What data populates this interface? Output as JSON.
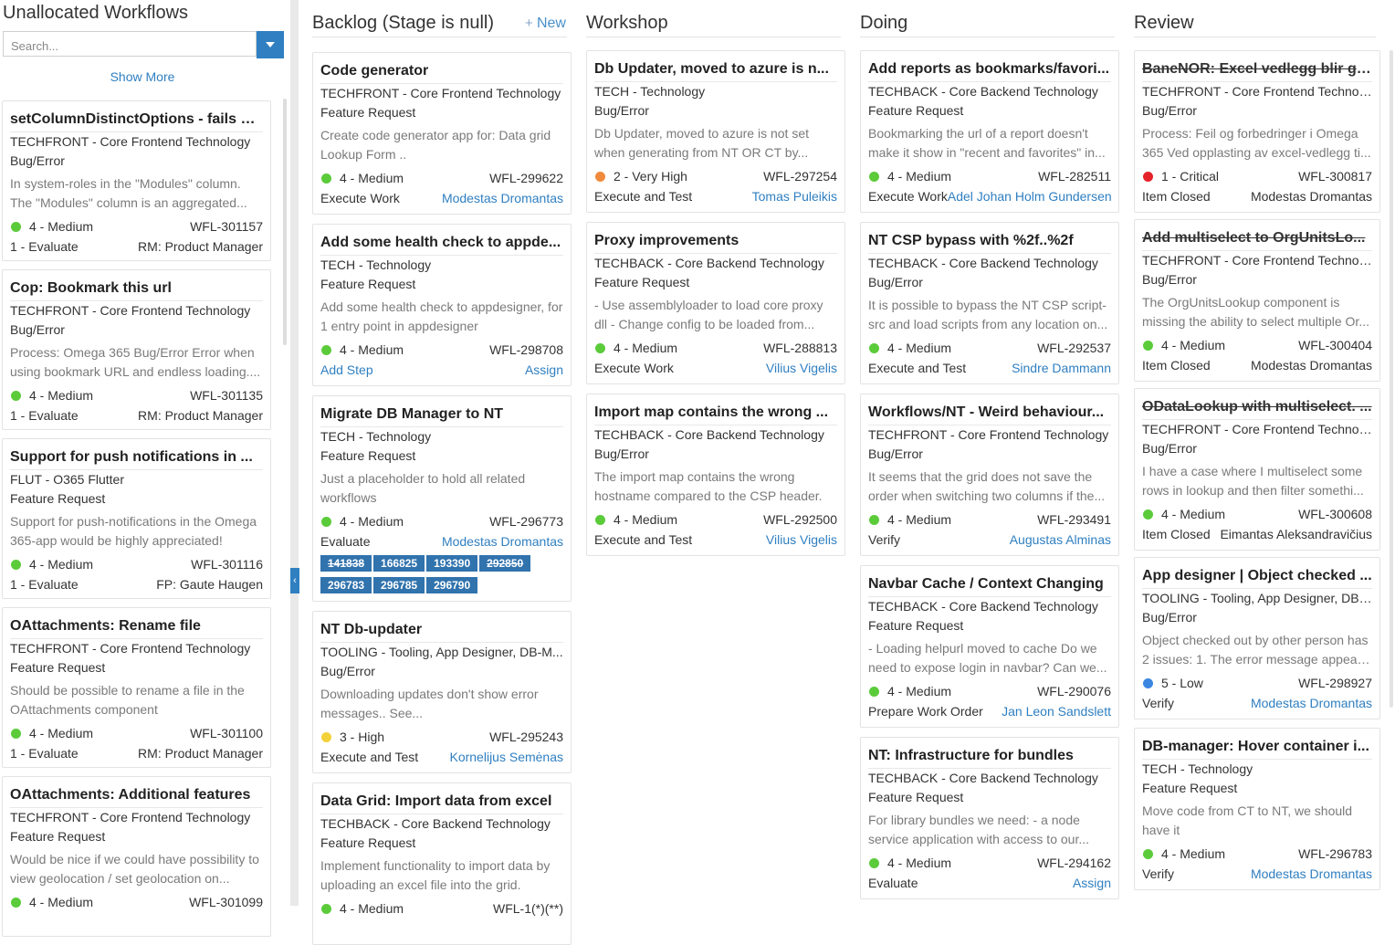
{
  "left_panel": {
    "title": "Unallocated Workflows",
    "search_placeholder": "Search...",
    "show_more": "Show More",
    "cards": [
      {
        "title": "setColumnDistinctOptions - fails w...",
        "product": "TECHFRONT - Core Frontend Technology",
        "type": "Bug/Error",
        "desc1": "In system-roles in the \"Modules\" column.",
        "desc2": "The \"Modules\" column is an aggregated...",
        "priority": "4 - Medium",
        "priority_color": "#5bcb3a",
        "id": "WFL-301157",
        "stage": "1 - Evaluate",
        "assignee": "RM: Product Manager"
      },
      {
        "title": "Cop: Bookmark this url",
        "product": "TECHFRONT - Core Frontend Technology",
        "type": "Bug/Error",
        "desc1": "Process: Omega 365 Bug/Error Error when",
        "desc2": "using bookmark URL and endless loading....",
        "priority": "4 - Medium",
        "priority_color": "#5bcb3a",
        "id": "WFL-301135",
        "stage": "1 - Evaluate",
        "assignee": "RM: Product Manager"
      },
      {
        "title": "Support for push notifications in ...",
        "product": "FLUT - O365 Flutter",
        "type": "Feature Request",
        "desc1": "Support for push-notifications in the Omega",
        "desc2": "365-app would be highly appreciated!",
        "priority": "4 - Medium",
        "priority_color": "#5bcb3a",
        "id": "WFL-301116",
        "stage": "1 - Evaluate",
        "assignee": "FP: Gaute Haugen"
      },
      {
        "title": "OAttachments: Rename file",
        "product": "TECHFRONT - Core Frontend Technology",
        "type": "Feature Request",
        "desc1": "Should be possible to rename a file in the",
        "desc2": "OAttachments component",
        "priority": "4 - Medium",
        "priority_color": "#5bcb3a",
        "id": "WFL-301100",
        "stage": "1 - Evaluate",
        "assignee": "RM: Product Manager"
      },
      {
        "title": "OAttachments: Additional features",
        "product": "TECHFRONT - Core Frontend Technology",
        "type": "Feature Request",
        "desc1": "Would be nice if we could have possibility to",
        "desc2": "view geolocation / set geolocation on...",
        "priority": "4 - Medium",
        "priority_color": "#5bcb3a",
        "id": "WFL-301099",
        "stage": "",
        "assignee": ""
      }
    ]
  },
  "columns": [
    {
      "title": "Backlog (Stage is null)",
      "new_label": "New",
      "cards": [
        {
          "title": "Code generator",
          "product": "TECHFRONT - Core Frontend Technology",
          "type": "Feature Request",
          "desc1": "Create code generator app for: Data grid",
          "desc2": "Lookup Form ..",
          "priority": "4 - Medium",
          "priority_color": "#5bcb3a",
          "id": "WFL-299622",
          "stage": "Execute Work",
          "assignee": "Modestas Dromantas"
        },
        {
          "title": "Add some health check to appde...",
          "product": "TECH - Technology",
          "type": "Feature Request",
          "desc1": "Add some health check to appdesigner, for",
          "desc2": "1 entry point in appdesigner",
          "priority": "4 - Medium",
          "priority_color": "#5bcb3a",
          "id": "WFL-298708",
          "stage": "Add Step",
          "stage_link": true,
          "assignee": "Assign"
        },
        {
          "title": "Migrate DB Manager to NT",
          "product": "TECH - Technology",
          "type": "Feature Request",
          "desc1": "Just a placeholder to hold all related",
          "desc2": "workflows",
          "priority": "4 - Medium",
          "priority_color": "#5bcb3a",
          "id": "WFL-296773",
          "stage": "Evaluate",
          "assignee": "Modestas Dromantas",
          "tags": [
            {
              "label": "141838",
              "struck": true
            },
            {
              "label": "166825",
              "struck": false
            },
            {
              "label": "193390",
              "struck": false
            },
            {
              "label": "292850",
              "struck": true
            },
            {
              "label": "296783",
              "struck": false
            },
            {
              "label": "296785",
              "struck": false
            },
            {
              "label": "296790",
              "struck": false
            }
          ]
        },
        {
          "title": "NT Db-updater",
          "product": "TOOLING - Tooling, App Designer, DB-M...",
          "type": "Bug/Error",
          "desc1": "Downloading updates don't show error",
          "desc2": "messages.. See...",
          "priority": "3 - High",
          "priority_color": "#f2d13a",
          "id": "WFL-295243",
          "stage": "Execute and Test",
          "assignee": "Kornelijus Semėnas"
        },
        {
          "title": "Data Grid: Import data from excel",
          "product": "TECHBACK - Core Backend Technology",
          "type": "Feature Request",
          "desc1": "Implement functionality to import data by",
          "desc2": "uploading an excel file into the grid.",
          "priority": "4 - Medium",
          "priority_color": "#5bcb3a",
          "id": "WFL-1(*)(**)",
          "stage": "",
          "assignee": ""
        }
      ]
    },
    {
      "title": "Workshop",
      "cards": [
        {
          "title": "Db Updater, moved to azure is n...",
          "product": "TECH - Technology",
          "type": "Bug/Error",
          "desc1": "Db Updater, moved to azure is not set",
          "desc2": "when generating from NT OR CT by...",
          "priority": "2 - Very High",
          "priority_color": "#f08a3c",
          "id": "WFL-297254",
          "stage": "Execute and Test",
          "assignee": "Tomas Puleikis"
        },
        {
          "title": "Proxy improvements",
          "product": "TECHBACK - Core Backend Technology",
          "type": "Feature Request",
          "desc1": "- Use assemblyloader to load core proxy",
          "desc2": "dll - Change config to be loaded from...",
          "priority": "4 - Medium",
          "priority_color": "#5bcb3a",
          "id": "WFL-288813",
          "stage": "Execute Work",
          "assignee": "Vilius Vigelis"
        },
        {
          "title": "Import map contains the wrong ...",
          "product": "TECHBACK - Core Backend Technology",
          "type": "Bug/Error",
          "desc1": "The import map contains the wrong",
          "desc2": "hostname compared to the CSP header.",
          "priority": "4 - Medium",
          "priority_color": "#5bcb3a",
          "id": "WFL-292500",
          "stage": "Execute and Test",
          "assignee": "Vilius Vigelis"
        }
      ]
    },
    {
      "title": "Doing",
      "cards": [
        {
          "title": "Add reports as bookmarks/favori...",
          "product": "TECHBACK - Core Backend Technology",
          "type": "Feature Request",
          "desc1": "Bookmarking the url of a report doesn't",
          "desc2": "make it show in \"recent and favorites\" in...",
          "priority": "4 - Medium",
          "priority_color": "#5bcb3a",
          "id": "WFL-282511",
          "stage": "Execute Work",
          "assignee": "Adel Johan Holm Gundersen"
        },
        {
          "title": "NT CSP bypass with %2f..%2f",
          "product": "TECHBACK - Core Backend Technology",
          "type": "Bug/Error",
          "desc1": "It is possible to bypass the NT CSP script-",
          "desc2": "src and load scripts from any location on...",
          "priority": "4 - Medium",
          "priority_color": "#5bcb3a",
          "id": "WFL-292537",
          "stage": "Execute and Test",
          "assignee": "Sindre Dammann"
        },
        {
          "title": "Workflows/NT - Weird behaviour...",
          "product": "TECHFRONT - Core Frontend Technology",
          "type": "Bug/Error",
          "desc1": "It seems that the grid does not save the",
          "desc2": "order when switching two columns if the...",
          "priority": "4 - Medium",
          "priority_color": "#5bcb3a",
          "id": "WFL-293491",
          "stage": "Verify",
          "assignee": "Augustas Alminas"
        },
        {
          "title": "Navbar Cache / Context Changing",
          "product": "TECHBACK - Core Backend Technology",
          "type": "Feature Request",
          "desc1": "- Loading helpurl moved to cache Do we",
          "desc2": "need to expose login in navbar? Can we...",
          "priority": "4 - Medium",
          "priority_color": "#5bcb3a",
          "id": "WFL-290076",
          "stage": "Prepare Work Order",
          "assignee": "Jan Leon Sandslett"
        },
        {
          "title": "NT: Infrastructure for bundles",
          "product": "TECHBACK - Core Backend Technology",
          "type": "Feature Request",
          "desc1": "For library bundles we need: - a node",
          "desc2": "service application with access to our...",
          "priority": "4 - Medium",
          "priority_color": "#5bcb3a",
          "id": "WFL-294162",
          "stage": "Evaluate",
          "assignee": "Assign"
        }
      ]
    },
    {
      "title": "Review",
      "cards": [
        {
          "title": "BaneNOR: Excel vedlegg blir gj...",
          "struck": true,
          "product": "TECHFRONT - Core Frontend Technolo...",
          "type": "Bug/Error",
          "desc1": "Process: Feil og forbedringer i Omega",
          "desc2": "365 Ved opplasting av excel-vedlegg ti...",
          "priority": "1 - Critical",
          "priority_color": "#e5222a",
          "id": "WFL-300817",
          "stage": "Item Closed",
          "assignee": "Modestas Dromantas",
          "plain_assignee": true
        },
        {
          "title": "Add multiselect to OrgUnitsLo...",
          "struck": true,
          "product": "TECHFRONT - Core Frontend Technolo...",
          "type": "Bug/Error",
          "desc1": "The OrgUnitsLookup component is",
          "desc2": "missing the ability to select multiple Or...",
          "priority": "4 - Medium",
          "priority_color": "#5bcb3a",
          "id": "WFL-300404",
          "stage": "Item Closed",
          "assignee": "Modestas Dromantas",
          "plain_assignee": true
        },
        {
          "title": "ODataLookup with multiselect. ...",
          "struck": true,
          "product": "TECHFRONT - Core Frontend Technolo...",
          "type": "Bug/Error",
          "desc1": "I have a case where I multiselect some",
          "desc2": "rows in lookup and then filter somethi...",
          "priority": "4 - Medium",
          "priority_color": "#5bcb3a",
          "id": "WFL-300608",
          "stage": "Item Closed",
          "assignee": "Eimantas Aleksandravičius",
          "plain_assignee": true
        },
        {
          "title": "App designer | Object checked ...",
          "product": "TOOLING - Tooling, App Designer, DB-...",
          "type": "Bug/Error",
          "desc1": "Object checked out by other person has",
          "desc2": "2 issues: 1. The error message appears...",
          "priority": "5 - Low",
          "priority_color": "#3b86e0",
          "id": "WFL-298927",
          "stage": "Verify",
          "assignee": "Modestas Dromantas"
        },
        {
          "title": "DB-manager: Hover container i...",
          "product": "TECH - Technology",
          "type": "Feature Request",
          "desc1": "Move code from CT to NT, we should",
          "desc2": "have it",
          "priority": "4 - Medium",
          "priority_color": "#5bcb3a",
          "id": "WFL-296783",
          "stage": "Verify",
          "assignee": "Modestas Dromantas"
        }
      ]
    }
  ]
}
